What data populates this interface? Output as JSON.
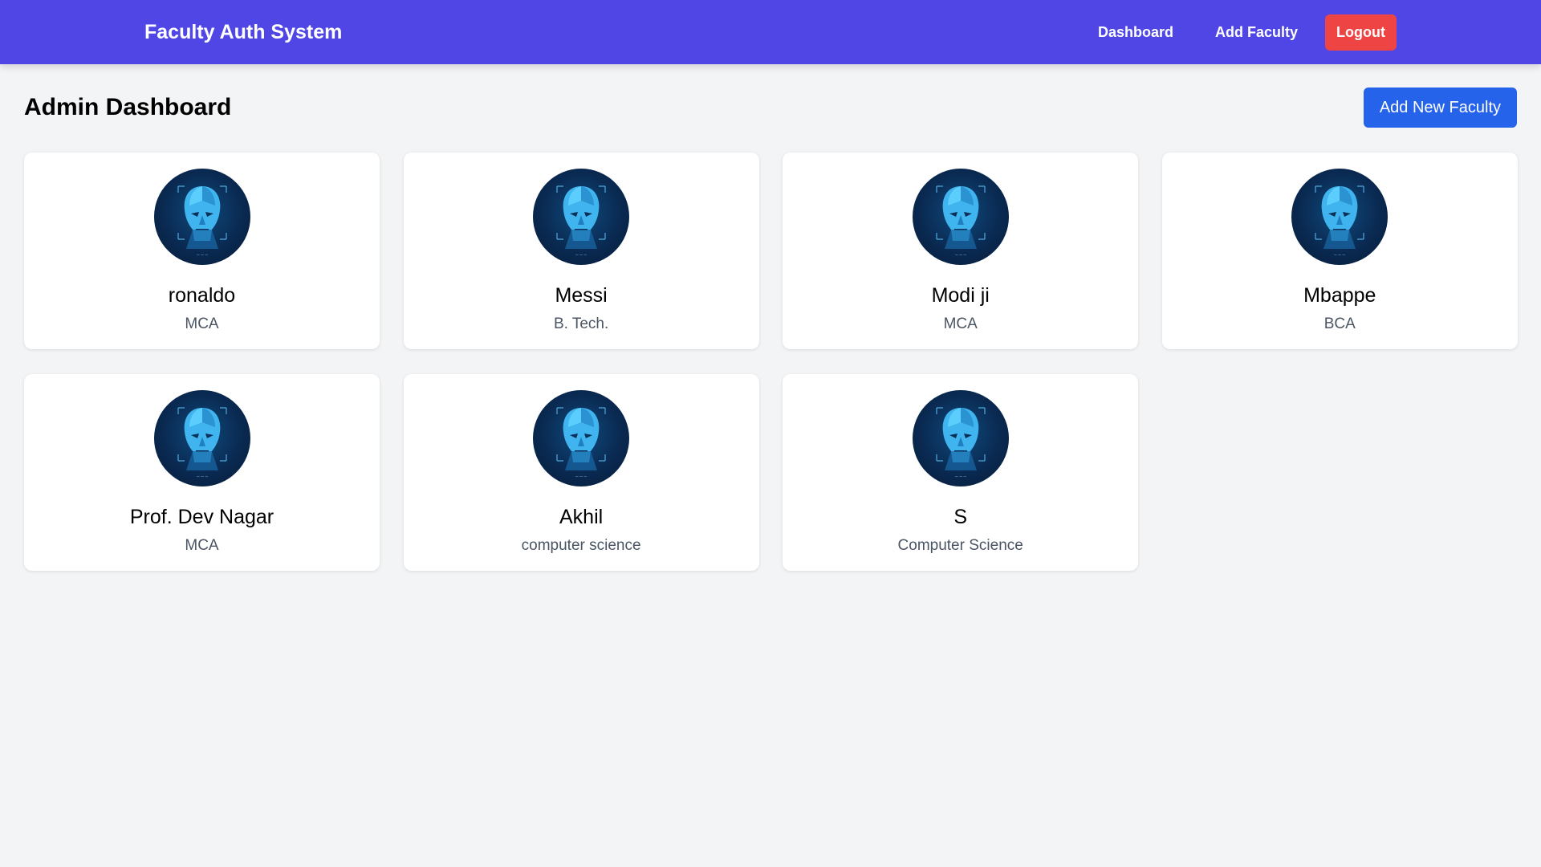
{
  "navbar": {
    "brand": "Faculty Auth System",
    "links": [
      "Dashboard",
      "Add Faculty"
    ],
    "logout_label": "Logout",
    "bg_color": "#4f46e5",
    "logout_color": "#ef4444"
  },
  "header": {
    "title": "Admin Dashboard",
    "add_button_label": "Add New Faculty",
    "add_button_color": "#2563eb"
  },
  "faculty": [
    {
      "name": "ronaldo",
      "department": "MCA",
      "avatar_icon": "face-scan-avatar"
    },
    {
      "name": "Messi",
      "department": "B. Tech.",
      "avatar_icon": "face-scan-avatar"
    },
    {
      "name": "Modi ji",
      "department": "MCA",
      "avatar_icon": "face-scan-avatar"
    },
    {
      "name": "Mbappe",
      "department": "BCA",
      "avatar_icon": "face-scan-avatar"
    },
    {
      "name": "Prof. Dev Nagar",
      "department": "MCA",
      "avatar_icon": "face-scan-avatar"
    },
    {
      "name": "Akhil",
      "department": "computer science",
      "avatar_icon": "face-scan-avatar"
    },
    {
      "name": "S",
      "department": "Computer Science",
      "avatar_icon": "face-scan-avatar"
    }
  ]
}
